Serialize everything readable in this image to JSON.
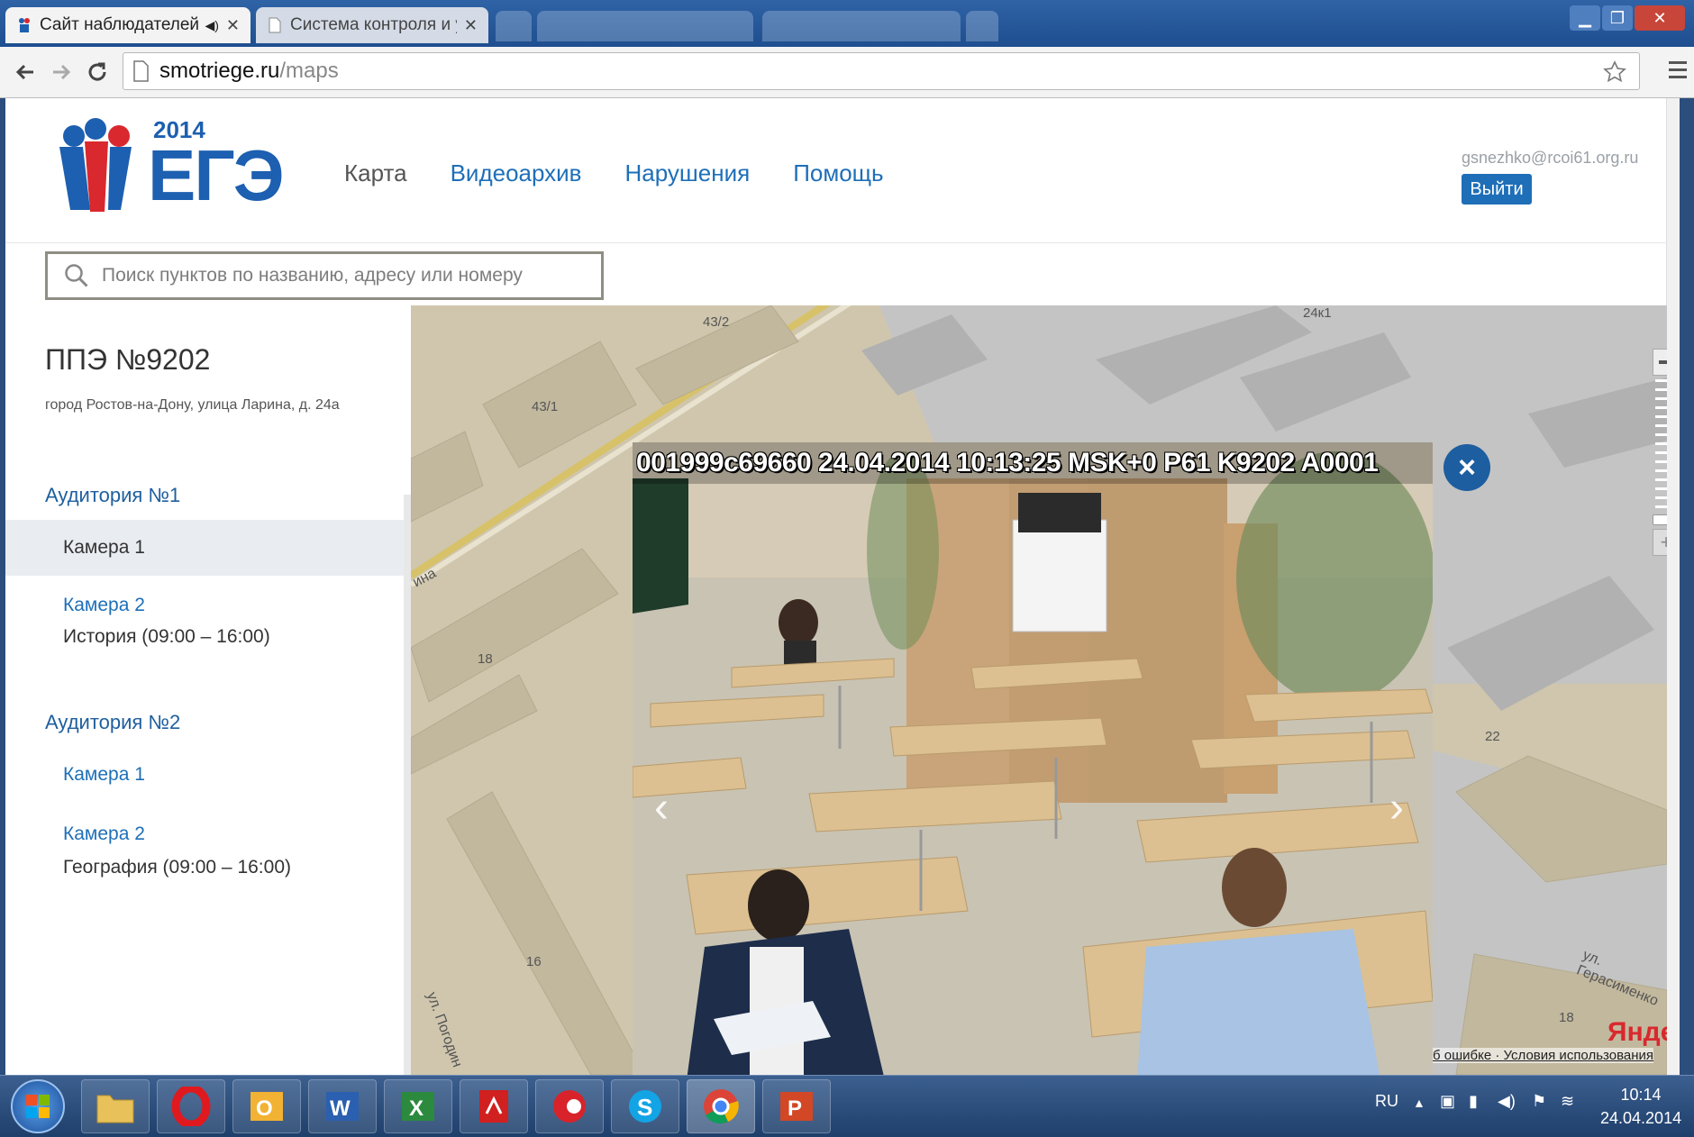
{
  "browser": {
    "tabs": [
      {
        "label": "Сайт наблюдателей Е",
        "active": true
      },
      {
        "label": "Система контроля и упр",
        "active": false
      }
    ],
    "url_host": "smotriege.ru",
    "url_path": "/maps"
  },
  "header": {
    "logo_year": "2014",
    "logo_text": "ЕГЭ",
    "nav": [
      "Карта",
      "Видеоархив",
      "Нарушения",
      "Помощь"
    ],
    "user_email": "gsnezhko@rcoi61.org.ru",
    "logout_label": "Выйти"
  },
  "search": {
    "placeholder": "Поиск пунктов по названию, адресу или номеру"
  },
  "sidebar": {
    "title": "ППЭ №9202",
    "address": "город Ростов-на-Дону, улица Ларина, д. 24а",
    "auditoriums": [
      {
        "label": "Аудитория №1",
        "cameras": [
          "Камера 1",
          "Камера 2"
        ],
        "subject": "История (09:00 – 16:00)"
      },
      {
        "label": "Аудитория №2",
        "cameras": [
          "Камера 1",
          "Камера 2"
        ],
        "subject": "География (09:00 – 16:00)"
      }
    ]
  },
  "map": {
    "labels": [
      "43/2",
      "43/1",
      "24к1",
      "18",
      "16",
      "22",
      "18"
    ],
    "street_labels": [
      "ина",
      "ул. Погодин",
      "ул. Герасименко"
    ],
    "yandex": "Яндекс",
    "links": "б ошибке · Условия использования"
  },
  "video": {
    "overlay": "001999c69660 24.04.2014 10:13:25 MSK+0 P61 K9202 A0001",
    "close": "×",
    "prev": "‹",
    "next": "›"
  },
  "taskbar": {
    "lang": "RU",
    "time": "10:14",
    "date": "24.04.2014"
  },
  "colors": {
    "accent": "#1e6fb8",
    "close_button": "#1c5ea0",
    "map_bg": "#cfc6ad"
  }
}
